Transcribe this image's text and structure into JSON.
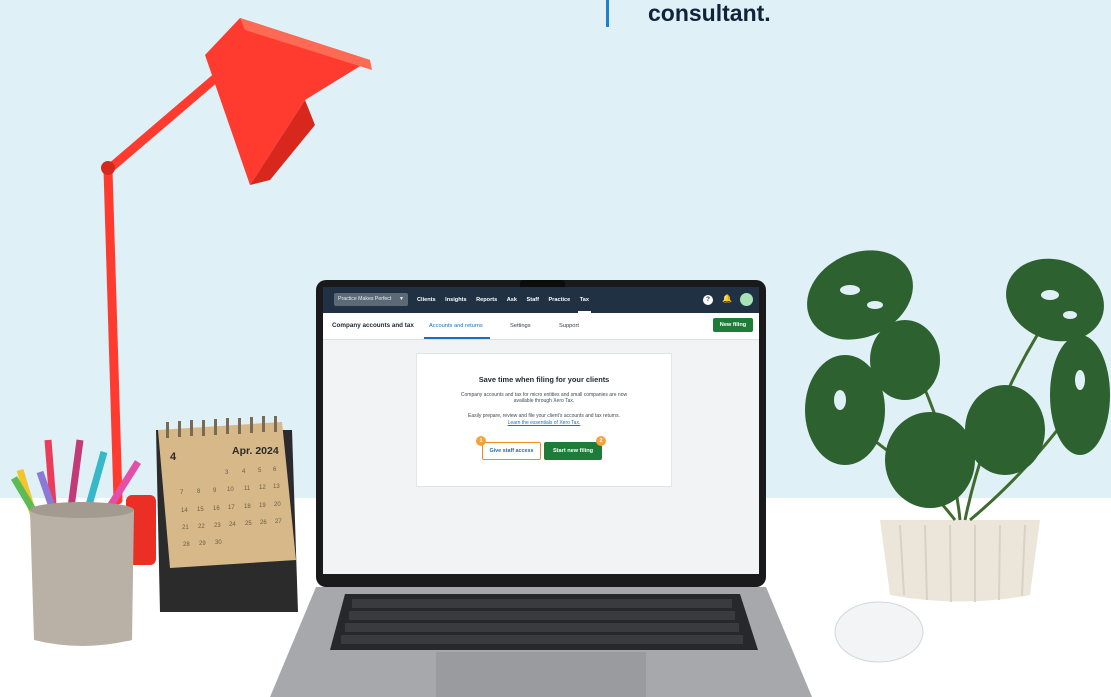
{
  "quote": {
    "text": "consultant."
  },
  "calendar": {
    "month_label": "Apr. 2024",
    "month_number": "4"
  },
  "app": {
    "org_switcher": "Practice Makes Perfect",
    "nav": [
      "Clients",
      "Insights",
      "Reports",
      "Ask",
      "Staff",
      "Practice",
      "Tax"
    ],
    "active_nav": "Tax",
    "help_icon": "?",
    "page_title": "Company accounts and tax",
    "tabs": [
      "Accounts and returns",
      "Settings",
      "Support"
    ],
    "active_tab": "Accounts and returns",
    "new_filing_button": "New filing",
    "card": {
      "title": "Save time when filing for your clients",
      "paragraph1": "Company accounts and tax for micro entities and small companies are now available through Xero Tax.",
      "paragraph2": "Easily prepare, review and file your client’s accounts and tax returns.",
      "link": "Learn the essentials of Xero Tax.",
      "give_staff_access_button": "Give staff access",
      "start_new_filing_button": "Start new filing",
      "step1": "1",
      "step2": "2"
    }
  },
  "colors": {
    "wall": "#dff0f6",
    "nav_bg": "#1f3142",
    "primary_green": "#1e7c39",
    "link_blue": "#1c6ebf",
    "step_orange": "#f5a23a",
    "lamp_red": "#ff3b30"
  },
  "icons": [
    "bell-icon",
    "help-icon",
    "avatar",
    "caret-down-icon"
  ]
}
